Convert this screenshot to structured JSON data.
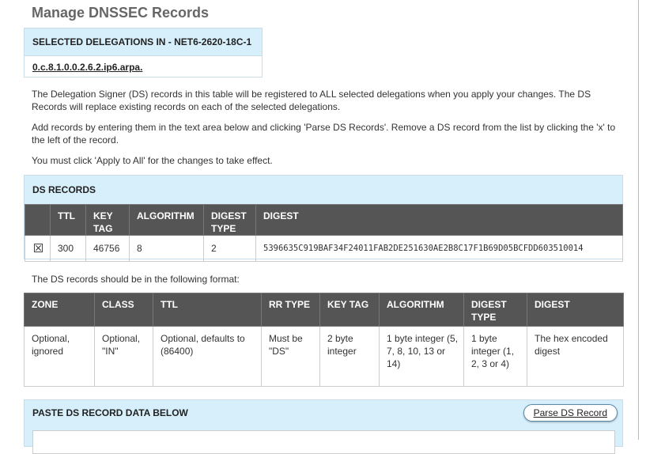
{
  "page": {
    "title": "Manage DNSSEC Records"
  },
  "delegations": {
    "header": "SELECTED DELEGATIONS IN - NET6-2620-18C-1",
    "items": [
      "0.c.8.1.0.0.2.6.2.ip6.arpa."
    ]
  },
  "intro": {
    "p1": "The Delegation Signer (DS) records in this table will be registered to ALL selected delegations when you apply your changes. The DS Records will replace existing records on each of the selected delegations.",
    "p2": "Add records by entering them in the text area below and clicking 'Parse DS Records'. Remove a DS record from the list by clicking the 'x' to the left of the record.",
    "p3": "You must click 'Apply to All' for the changes to take effect."
  },
  "ds_records": {
    "header": "DS RECORDS",
    "columns": [
      "",
      "TTL",
      "KEY TAG",
      "ALGORITHM",
      "DIGEST TYPE",
      "DIGEST"
    ],
    "rows": [
      {
        "ttl": "300",
        "key_tag": "46756",
        "algorithm": "8",
        "digest_type": "2",
        "digest": "5396635C919BAF34F24011FAB2DE251630AE2B8C17F1B69D05BCFDD603510014"
      }
    ]
  },
  "format_note": "The DS records should be in the following format:",
  "format_table": {
    "columns": [
      "ZONE",
      "CLASS",
      "TTL",
      "RR TYPE",
      "KEY TAG",
      "ALGORITHM",
      "DIGEST TYPE",
      "DIGEST"
    ],
    "row": [
      "Optional, ignored",
      "Optional, \"IN\"",
      "Optional, defaults to (86400)",
      "Must be \"DS\"",
      "2 byte integer",
      "1 byte integer (5, 7, 8, 10, 13 or 14)",
      "1 byte integer (1, 2, 3 or 4)",
      "The hex encoded digest"
    ]
  },
  "paste": {
    "header": "PASTE DS RECORD DATA BELOW",
    "parse_button": "Parse DS Record"
  }
}
